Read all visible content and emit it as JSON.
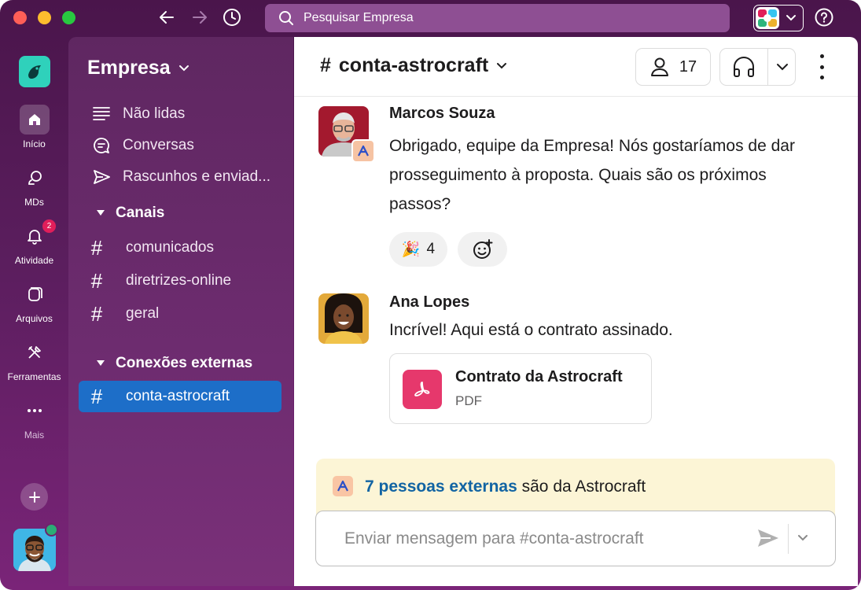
{
  "titlebar": {
    "search_placeholder": "Pesquisar Empresa"
  },
  "rail": {
    "items": [
      {
        "label": "Início",
        "icon": "home-icon"
      },
      {
        "label": "MDs",
        "icon": "dm-icon"
      },
      {
        "label": "Atividade",
        "icon": "bell-icon",
        "badge": "2"
      },
      {
        "label": "Arquivos",
        "icon": "files-icon"
      },
      {
        "label": "Ferramentas",
        "icon": "tools-icon"
      },
      {
        "label": "Mais",
        "icon": "more-icon"
      }
    ]
  },
  "sidebar": {
    "workspace_name": "Empresa",
    "nav": [
      {
        "label": "Não lidas",
        "icon": "unread-icon"
      },
      {
        "label": "Conversas",
        "icon": "threads-icon"
      },
      {
        "label": "Rascunhos e enviad...",
        "icon": "send-icon"
      }
    ],
    "sections": {
      "channels_title": "Canais",
      "external_title": "Conexões externas"
    },
    "channels": [
      "comunicados",
      "diretrizes-online",
      "geral"
    ],
    "external_channels": [
      "conta-astrocraft"
    ]
  },
  "channel": {
    "name": "conta-astrocraft",
    "member_count": "17"
  },
  "messages": [
    {
      "author": "Marcos Souza",
      "text": "Obrigado, equipe da Empresa! Nós gostaríamos de dar prosseguimento à proposta. Quais são os próximos passos?",
      "reactions": [
        {
          "emoji": "🎉",
          "count": "4"
        }
      ]
    },
    {
      "author": "Ana Lopes",
      "text": "Incrível! Aqui está o contrato assinado.",
      "attachment": {
        "name": "Contrato da Astrocraft",
        "type": "PDF"
      }
    }
  ],
  "external_banner": {
    "link": "7 pessoas externas",
    "rest": " são da Astrocraft"
  },
  "composer": {
    "placeholder": "Enviar mensagem para #conta-astrocraft"
  },
  "colors": {
    "sidebar": "#5f2761",
    "active_channel": "#1d6ec8",
    "link": "#1264a3",
    "banner": "#fcf5d6"
  }
}
